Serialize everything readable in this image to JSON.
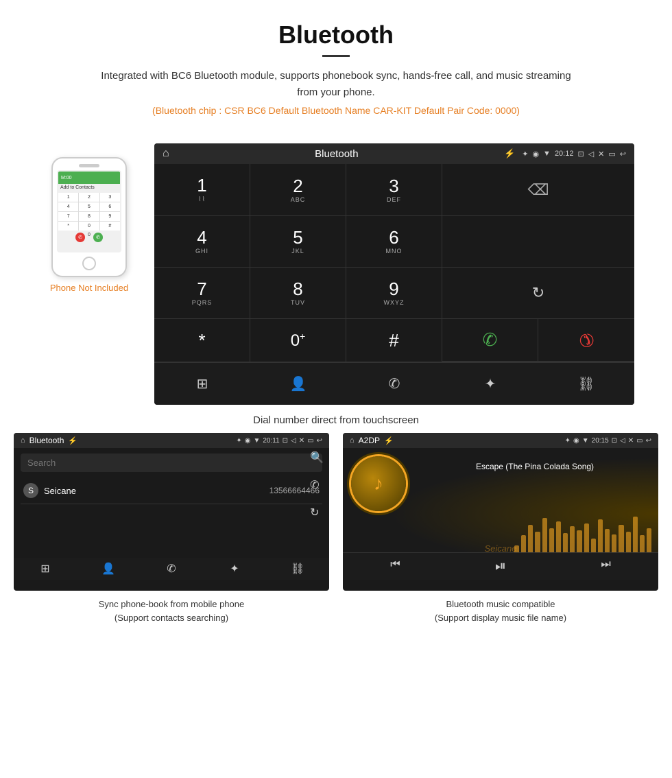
{
  "header": {
    "title": "Bluetooth",
    "description": "Integrated with BC6 Bluetooth module, supports phonebook sync, hands-free call, and music streaming from your phone.",
    "bluetooth_info": "(Bluetooth chip : CSR BC6    Default Bluetooth Name CAR-KIT    Default Pair Code: 0000)"
  },
  "phone_illustration": {
    "not_included_label": "Phone Not Included",
    "screen_header": "M:00",
    "add_to_contacts": "Add to Contacts",
    "keypad_keys": [
      "1",
      "2",
      "3",
      "4",
      "5",
      "6",
      "7",
      "8",
      "9",
      "*",
      "0",
      "#"
    ]
  },
  "dial_screen": {
    "status_bar": {
      "home_icon": "⌂",
      "title": "Bluetooth",
      "usb_icon": "⚡",
      "bluetooth_icon": "✦",
      "location_icon": "◉",
      "wifi_icon": "▼",
      "time": "20:12",
      "camera_icon": "⊡",
      "volume_icon": "◁",
      "close_icon": "✕",
      "screen_icon": "▭",
      "back_icon": "↩"
    },
    "keys": [
      {
        "main": "1",
        "sub": "⌇⌇"
      },
      {
        "main": "2",
        "sub": "ABC"
      },
      {
        "main": "3",
        "sub": "DEF"
      },
      {
        "main": "4",
        "sub": "GHI"
      },
      {
        "main": "5",
        "sub": "JKL"
      },
      {
        "main": "6",
        "sub": "MNO"
      },
      {
        "main": "7",
        "sub": "PQRS"
      },
      {
        "main": "8",
        "sub": "TUV"
      },
      {
        "main": "9",
        "sub": "WXYZ"
      },
      {
        "main": "*",
        "sub": ""
      },
      {
        "main": "0",
        "sub": "+"
      },
      {
        "main": "#",
        "sub": ""
      }
    ],
    "backspace_icon": "⌫",
    "refresh_icon": "↻",
    "call_icon": "✆",
    "end_call_icon": "✆",
    "bottom_nav": [
      "⊞",
      "👤",
      "✆",
      "✦",
      "⛓"
    ]
  },
  "dial_caption": "Dial number direct from touchscreen",
  "contacts_screen": {
    "status_bar": {
      "home_icon": "⌂",
      "title": "Bluetooth",
      "usb_icon": "⚡",
      "bluetooth_icon": "✦",
      "location_icon": "◉",
      "wifi_icon": "▼",
      "time": "20:11",
      "icons": "⊡ ◁ ✕ ▭ ↩"
    },
    "search_placeholder": "Search",
    "contact": {
      "letter": "S",
      "name": "Seicane",
      "number": "13566664466"
    },
    "right_icons": [
      "🔍",
      "✆",
      "↻"
    ],
    "bottom_nav": [
      "⊞",
      "👤",
      "✆",
      "✦",
      "⛓"
    ]
  },
  "contacts_caption": {
    "line1": "Sync phone-book from mobile phone",
    "line2": "(Support contacts searching)"
  },
  "music_screen": {
    "status_bar": {
      "home_icon": "⌂",
      "title": "A2DP",
      "usb_icon": "⚡",
      "bluetooth_icon": "✦",
      "location_icon": "◉",
      "wifi_icon": "▼",
      "time": "20:15",
      "icons": "⊡ ◁ ✕ ▭ ↩"
    },
    "song_title": "Escape (The Pina Colada Song)",
    "music_icon": "♪",
    "bluetooth_symbol": "✦",
    "eq_bars": [
      20,
      35,
      50,
      40,
      60,
      45,
      55,
      38,
      48,
      42,
      52,
      30,
      58,
      44,
      36,
      50,
      40,
      62,
      35,
      45
    ],
    "bottom_nav": [
      "⏮",
      "⏯",
      "⏭"
    ],
    "watermark": "Seicane"
  },
  "music_caption": {
    "line1": "Bluetooth music compatible",
    "line2": "(Support display music file name)"
  }
}
